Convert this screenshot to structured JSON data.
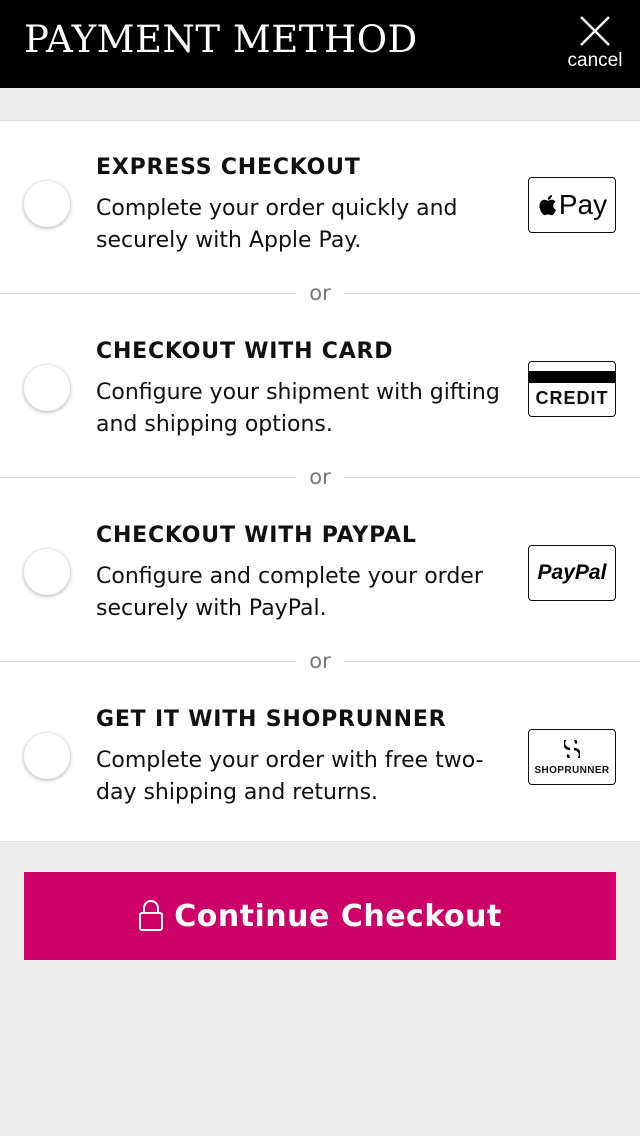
{
  "header": {
    "title": "PAYMENT METHOD",
    "cancel_label": "cancel"
  },
  "options": [
    {
      "title": "EXPRESS CHECKOUT",
      "description": "Complete your order quickly and securely with Apple Pay.",
      "logo_text": "Pay",
      "logo_icon": "apple-icon"
    },
    {
      "title": "CHECKOUT WITH CARD",
      "description": "Configure your shipment with gifting and shipping options.",
      "logo_text": "CREDIT",
      "logo_icon": "credit-card-icon"
    },
    {
      "title": "CHECKOUT WITH PAYPAL",
      "description": "Configure and complete your order securely with PayPal.",
      "logo_text": "PayPal",
      "logo_icon": "paypal-logo"
    },
    {
      "title": "GET IT WITH SHOPRUNNER",
      "description": "Complete your order with free two-day shipping and returns.",
      "logo_text": "SHOPRUNNER",
      "logo_icon": "shoprunner-logo"
    }
  ],
  "separator_label": "or",
  "cta": {
    "label": "Continue Checkout",
    "icon": "lock-icon"
  },
  "colors": {
    "header_bg": "#000000",
    "cta_bg": "#cc0066",
    "page_bg": "#ececec"
  }
}
